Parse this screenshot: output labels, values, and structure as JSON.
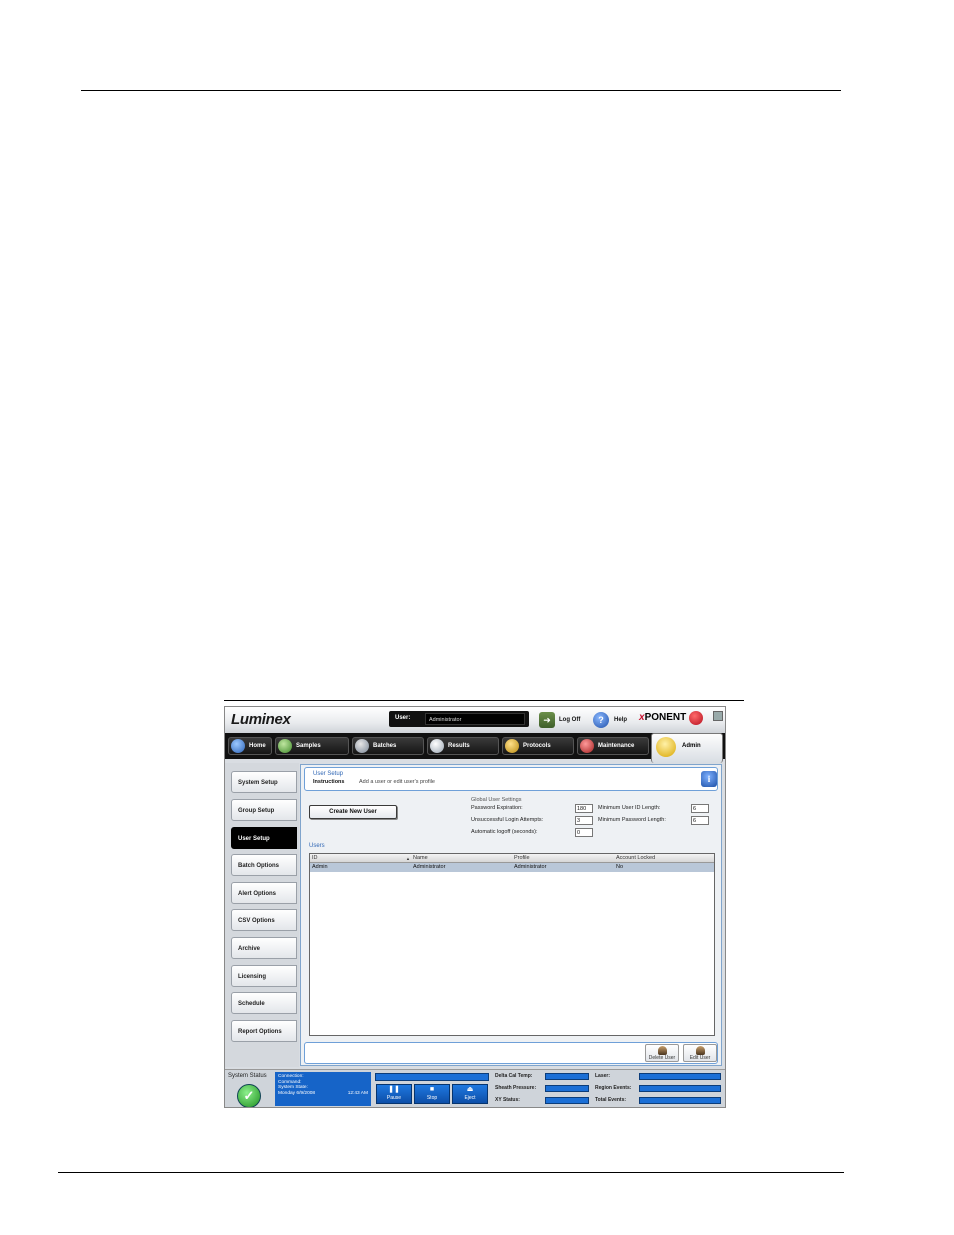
{
  "app": {
    "logo": "Luminex",
    "brand_prefix": "x",
    "brand_name": "PONENT",
    "user_label": "User:",
    "user_value": "Administrator",
    "logoff_label": "Log Off",
    "help_label": "Help"
  },
  "nav": {
    "tabs": [
      "Home",
      "Samples",
      "Batches",
      "Results",
      "Protocols",
      "Maintenance"
    ],
    "active": "Admin"
  },
  "sidebar": {
    "items": [
      "System Setup",
      "Group Setup",
      "User Setup",
      "Batch Options",
      "Alert Options",
      "CSV Options",
      "Archive",
      "Licensing",
      "Schedule",
      "Report Options"
    ],
    "active_index": 2
  },
  "header": {
    "title": "User Setup",
    "instructions_label": "Instructions",
    "instructions_text": "Add a user or edit user's profile"
  },
  "create_button": "Create New User",
  "global_settings": {
    "title": "Global User Settings",
    "password_expiration_label": "Password Expiration:",
    "password_expiration": "180",
    "login_attempts_label": "Unsuccessful Login Attempts:",
    "login_attempts": "3",
    "auto_logoff_label": "Automatic logoff (seconds):",
    "auto_logoff": "0",
    "min_userid_label": "Minimum User ID Length:",
    "min_userid": "6",
    "min_password_label": "Minimum Password Length:",
    "min_password": "6"
  },
  "users": {
    "title": "Users",
    "columns": [
      "ID",
      "Name",
      "Profile",
      "Account Locked"
    ],
    "rows": [
      [
        "Admin",
        "Administrator",
        "Administrator",
        "No"
      ]
    ]
  },
  "footer": {
    "delete_label": "Delete User",
    "edit_label": "Edit User"
  },
  "status": {
    "system_status_label": "System Status",
    "connection_label": "Connection:",
    "command_label": "Command:",
    "system_state_label": "System State:",
    "date": "Monday 6/9/2008",
    "time": "12:43 AM",
    "pause_label": "Pause",
    "stop_label": "Stop",
    "eject_label": "Eject",
    "delta_cal_temp_label": "Delta Cal Temp:",
    "sheath_pressure_label": "Sheath Pressure:",
    "xy_status_label": "XY Status:",
    "laser_label": "Laser:",
    "region_events_label": "Region Events:",
    "total_events_label": "Total Events:"
  },
  "colors": {
    "accent_blue": "#1664c8",
    "brand_red": "#c8102e",
    "status_ok": "#1f8f1f"
  }
}
